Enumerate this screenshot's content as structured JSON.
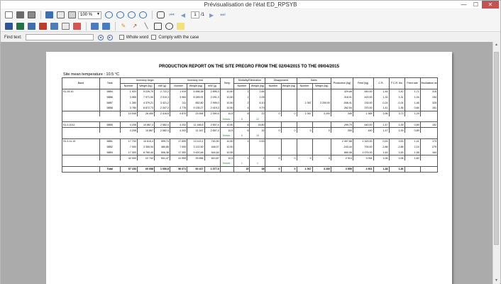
{
  "window": {
    "title": "Prévisualisation de l'état ED_RPSYB",
    "minimize": "—",
    "maximize": "☐",
    "close": "✕"
  },
  "toolbar": {
    "zoom": "100 %",
    "page_current": "1",
    "page_total": "/1"
  },
  "findbar": {
    "label": "Find text:",
    "search_value": "",
    "whole_word": "Whole word",
    "comply_case": "Comply with the case",
    "prev": "◂",
    "next": "▸"
  },
  "report": {
    "title": "PRODUCTION REPORT ON THE SITE PREGRO FROM THE 02/04/2015 TO THE 09/04/2015",
    "temperature": "Site mean temperature : 10.5 °C",
    "headers": {
      "band": "Band",
      "tank": "Tank",
      "inventory_begin": "Inventory begin",
      "inventory_end": "Inventory end",
      "temp": "Temp",
      "mortality": "Mortality/Elimination",
      "disappeared": "Disappeared",
      "sales": "Sales",
      "production": "Production (kg)",
      "feed": "Feed (kg)",
      "cr": "C.R.",
      "fcr": "F.C.R. bio",
      "feed_rate": "Feed rate",
      "modulation": "Modulation average",
      "number": "Number",
      "weight_kg": "Weight (kg)",
      "mw_kg": "mW (g)",
      "weight_g": "Weight (kg)"
    },
    "rows": [
      {
        "band": "S1.15.10",
        "tank": "58B4",
        "c": [
          "1 920",
          "5 226,70",
          "2 722,2",
          "1 919",
          "5 556,38",
          "2 895,3",
          "10,50",
          "1",
          "2,84",
          "",
          "",
          "",
          "",
          "329,68",
          "440,00",
          "1,44",
          "1,42",
          "1,71",
          "315"
        ]
      },
      {
        "band": "",
        "tank": "58B6",
        "c": [
          "3 965",
          "7 971,00",
          "2 010,3",
          "3 964",
          "8 289,91",
          "2 091,3",
          "10,50",
          "1",
          "2,05",
          "",
          "",
          "",
          "",
          "318,91",
          "420,00",
          "1,32",
          "1,31",
          "1,04",
          "154"
        ]
      },
      {
        "band": "",
        "tank": "58B7",
        "c": [
          "1 280",
          "4 379,21",
          "3 421,2",
          "211",
          "652,80",
          "2 999,0",
          "10,50",
          "2",
          "6,10",
          "",
          "",
          "1 067",
          "3 200,00",
          "-546,41",
          "130,00",
          "-0,24",
          "-0,24",
          "1,46",
          "325"
        ]
      },
      {
        "band": "",
        "tank": "58B8",
        "c": [
          "3 780",
          "8 872,73",
          "2 347,2",
          "3 776",
          "9 135,27",
          "2 419,3",
          "10,50",
          "4",
          "9,79",
          "",
          "",
          "",
          "",
          "262,54",
          "370,00",
          "1,41",
          "1,36",
          "0,84",
          "151"
        ]
      },
      {
        "band": "",
        "tank": "",
        "sub": true,
        "c": [
          "10 945",
          "26 450",
          "2 416,6",
          "9 870",
          "23 594",
          "2 390,5",
          "10,5",
          "8",
          "22",
          "0",
          "0",
          "1 067",
          "3 200",
          "345",
          "1 365",
          "3,96",
          "3,73",
          "1,29",
          ""
        ]
      },
      {
        "dead": true,
        "label": "Deads :",
        "m": "8",
        "w": "22"
      },
      {
        "band": "S1.3.1012",
        "tank": "58B5",
        "sub": true,
        "c": [
          "4 208",
          "10 867,3",
          "2 582,4",
          "4 202",
          "11 166,6",
          "2 657,4",
          "10,50",
          "6",
          "15,80",
          "",
          "",
          "",
          "",
          "299,79",
          "440,00",
          "1,47",
          "1,39",
          "0,89",
          "152"
        ]
      },
      {
        "band": "",
        "tank": "",
        "sub": true,
        "c": [
          "4 208",
          "10 867",
          "2 582,4",
          "4 202",
          "11 167",
          "2 657,4",
          "10,5",
          "6",
          "16",
          "0",
          "0",
          "0",
          "0",
          "300",
          "440",
          "1,47",
          "1,39",
          "0,89",
          ""
        ]
      },
      {
        "dead": true,
        "label": "Deads :",
        "m": "6",
        "w": "16"
      },
      {
        "band": "S1.3.11.13",
        "tank": "58B1",
        "sub": true,
        "c": [
          "17 700",
          "10 615,4",
          "599,74",
          "17 699",
          "13 113,1",
          "740,90",
          "10,50",
          "1",
          "0,53",
          "",
          "",
          "",
          "",
          "2 497,68",
          "1 320,00",
          "0,53",
          "0,53",
          "1,41",
          "173"
        ]
      },
      {
        "band": "",
        "tank": "58B2",
        "c": [
          "7 000",
          "3 355,94",
          "480,85",
          "7 000",
          "3 122,50",
          "446,07",
          "10,50",
          "",
          "",
          "",
          "",
          "",
          "",
          "-243,44",
          "700,00",
          "-2,88",
          "-2,88",
          "2,15",
          "279"
        ]
      },
      {
        "band": "",
        "tank": "58B3",
        "c": [
          "17 300",
          "8 760,40",
          "506,38",
          "17 300",
          "9 420,48",
          "544,54",
          "10,55",
          "",
          "",
          "",
          "",
          "",
          "",
          "660,08",
          "1 074,00",
          "1,63",
          "1,63",
          "1,58",
          "164"
        ]
      },
      {
        "band": "",
        "tank": "",
        "sub": true,
        "c": [
          "42 000",
          "22 742",
          "541,47",
          "41 999",
          "25 656",
          "610,87",
          "10,5",
          "1",
          "1",
          "0",
          "0",
          "0",
          "0",
          "2 914",
          "3 094",
          "1,06",
          "1,06",
          "1,82",
          ""
        ]
      },
      {
        "dead": true,
        "label": "Deads :",
        "m": "1",
        "w": "1"
      }
    ],
    "total": {
      "label": "Total",
      "c": [
        "57 153",
        "60 058",
        "1 050,8",
        "56 071",
        "60 417",
        "1 077,5",
        "",
        "15",
        "38",
        "0",
        "0",
        "1 067",
        "3 200",
        "3 559",
        "4 901",
        "1,38",
        "1,36",
        "",
        ""
      ]
    }
  }
}
